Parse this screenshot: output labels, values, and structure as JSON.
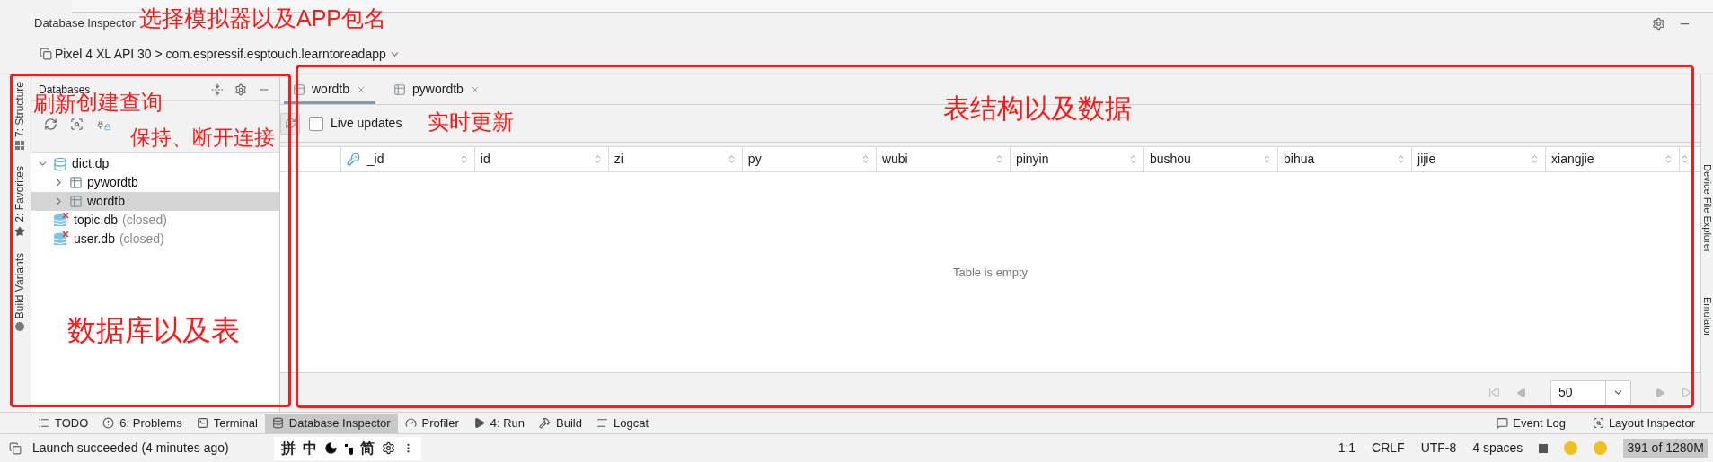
{
  "tool_window": {
    "title": "Database Inspector"
  },
  "device_selector": {
    "value": "Pixel 4 XL API 30 > com.espressif.esptouch.learntoreadapp"
  },
  "left_stripe_tabs": [
    {
      "label": "7: Structure",
      "kind": "structure"
    },
    {
      "label": "2: Favorites",
      "kind": "favorites"
    },
    {
      "label": "Build Variants",
      "kind": "variants"
    }
  ],
  "databases_panel": {
    "title": "Databases",
    "tree": [
      {
        "name": "dict.dp",
        "kind": "open",
        "expanded": true,
        "selected": false,
        "children": [
          {
            "name": "pywordtb",
            "kind": "table",
            "expanded": false,
            "selected": false
          },
          {
            "name": "wordtb",
            "kind": "table",
            "expanded": false,
            "selected": true
          }
        ]
      },
      {
        "name": "topic.db",
        "note": "(closed)",
        "kind": "closed",
        "selected": false
      },
      {
        "name": "user.db",
        "note": "(closed)",
        "kind": "closed",
        "selected": false
      }
    ]
  },
  "tabs": [
    {
      "label": "wordtb",
      "selected": true
    },
    {
      "label": "pywordtb",
      "selected": false
    }
  ],
  "live_updates": {
    "label": "Live updates",
    "checked": false
  },
  "table": {
    "columns": [
      {
        "label": "_id",
        "kind": "key"
      },
      {
        "label": "id",
        "kind": "plain"
      },
      {
        "label": "zi",
        "kind": "plain"
      },
      {
        "label": "py",
        "kind": "plain"
      },
      {
        "label": "wubi",
        "kind": "plain"
      },
      {
        "label": "pinyin",
        "kind": "plain"
      },
      {
        "label": "bushou",
        "kind": "plain"
      },
      {
        "label": "bihua",
        "kind": "plain"
      },
      {
        "label": "jijie",
        "kind": "plain"
      },
      {
        "label": "xiangjie",
        "kind": "plain"
      }
    ],
    "empty_message": "Table is empty"
  },
  "pagination": {
    "page_size": "50"
  },
  "right_stripe_tabs": [
    {
      "label": "Device File Explorer"
    },
    {
      "label": "Emulator"
    }
  ],
  "bottom_tools": [
    {
      "label": "TODO",
      "kind": "list",
      "selected": false
    },
    {
      "label": "6: Problems",
      "kind": "problems",
      "selected": false
    },
    {
      "label": "Terminal",
      "kind": "terminal",
      "selected": false
    },
    {
      "label": "Database Inspector",
      "kind": "database",
      "selected": true
    },
    {
      "label": "Profiler",
      "kind": "profiler",
      "selected": false
    },
    {
      "label": "4: Run",
      "kind": "run",
      "selected": false
    },
    {
      "label": "Build",
      "kind": "build",
      "selected": false
    },
    {
      "label": "Logcat",
      "kind": "logcat",
      "selected": false
    }
  ],
  "right_bottom_tools": [
    {
      "label": "Event Log",
      "kind": "event"
    },
    {
      "label": "Layout Inspector",
      "kind": "layout"
    }
  ],
  "status_bar": {
    "message": "Launch succeeded (4 minutes ago)",
    "items": [
      "1:1",
      "CRLF",
      "UTF-8",
      "4 spaces"
    ],
    "memory": "391 of 1280M"
  },
  "ime_toolbar": [
    {
      "kind": "text",
      "label": "拼"
    },
    {
      "kind": "text",
      "label": "中"
    },
    {
      "kind": "moon"
    },
    {
      "kind": "punct"
    },
    {
      "kind": "text",
      "label": "简"
    },
    {
      "kind": "gear"
    },
    {
      "kind": "more"
    }
  ],
  "annotations": [
    {
      "text": "选择模拟器以及APP包名"
    },
    {
      "text": "刷新"
    },
    {
      "text": "创建查询"
    },
    {
      "text": "保持、断开连接"
    },
    {
      "text": "实时更新"
    },
    {
      "text": "表结构以及数据"
    },
    {
      "text": "数据库以及表"
    }
  ]
}
